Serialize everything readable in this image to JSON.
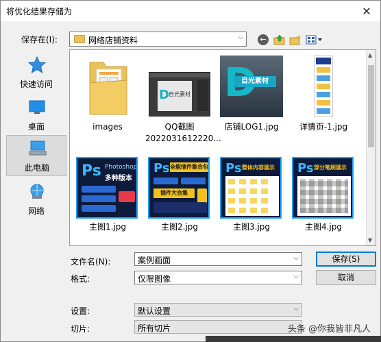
{
  "window": {
    "title": "将优化结果存储为",
    "close_symbol": "✕"
  },
  "toolbar": {
    "save_in_label": "保存在(I):",
    "current_folder": "网络店铺资料",
    "dropdown_symbol": "⌵",
    "icons": [
      "back-icon",
      "up-folder-icon",
      "new-folder-icon",
      "view-menu-icon"
    ]
  },
  "sidebar": {
    "items": [
      {
        "label": "快速访问",
        "icon": "star-icon"
      },
      {
        "label": "桌面",
        "icon": "desktop-icon"
      },
      {
        "label": "此电脑",
        "icon": "computer-icon",
        "selected": true
      },
      {
        "label": "网络",
        "icon": "network-icon"
      }
    ]
  },
  "files": [
    {
      "label": "images",
      "type": "folder"
    },
    {
      "label": "QQ截图2022031612220...",
      "label_line1": "QQ截图",
      "label_line2": "2022031612220...",
      "type": "image"
    },
    {
      "label": "店铺LOG1.jpg",
      "type": "image"
    },
    {
      "label": "详情页-1.jpg",
      "type": "image"
    },
    {
      "label": "主图1.jpg",
      "type": "image"
    },
    {
      "label": "主图2.jpg",
      "type": "image"
    },
    {
      "label": "主图3.jpg",
      "type": "image"
    },
    {
      "label": "主图4.jpg",
      "type": "image"
    }
  ],
  "thumb_text": {
    "ps": "Ps",
    "photoshop": "Photoshop",
    "versions": "多种版本",
    "img2": "全能插件集合包",
    "img2b": "插件大合集",
    "img3": "整体内容展示",
    "img4": "部分笔刷展示",
    "logo": "自光素材",
    "logo_d": "D"
  },
  "form": {
    "filename_label": "文件名(N):",
    "filename_value": "案例画面",
    "format_label": "格式:",
    "format_value": "仅限图像",
    "settings_label": "设置:",
    "settings_value": "默认设置",
    "slices_label": "切片:",
    "slices_value": "所有切片"
  },
  "buttons": {
    "save": "保存(S)",
    "cancel": "取消"
  },
  "watermark": "头条 @你我皆非凡人",
  "colors": {
    "accent": "#0078d7",
    "folder": "#e9c25b",
    "ps_blue": "#38b6ff",
    "ps_bg": "#0d1a3a"
  }
}
